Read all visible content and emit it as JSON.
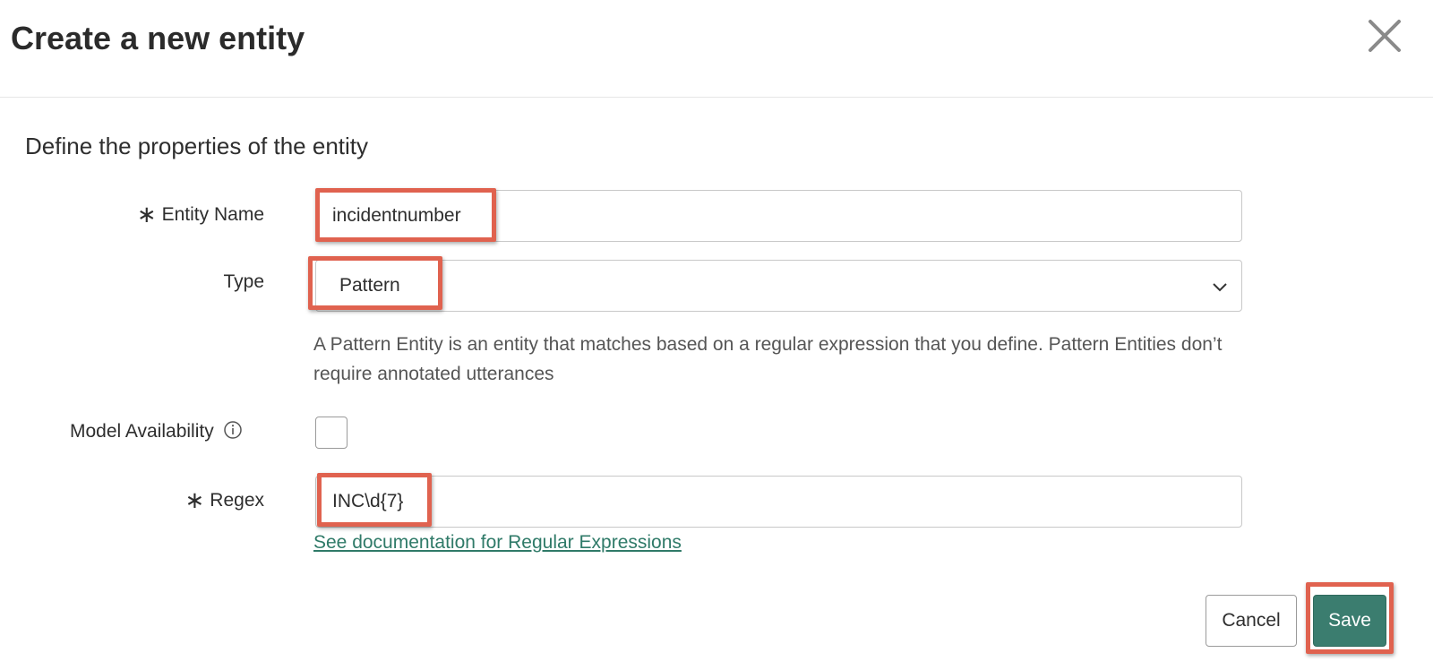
{
  "dialog": {
    "title": "Create a new entity",
    "close_icon": "close-icon"
  },
  "form": {
    "section_title": "Define the properties of the entity",
    "entity_name": {
      "label": "Entity Name",
      "required_marker": "∗",
      "value": "incidentnumber"
    },
    "type": {
      "label": "Type",
      "selected": "Pattern",
      "help_text": "A Pattern Entity is an entity that matches based on a regular expression that you define. Pattern Entities don’t require annotated utterances"
    },
    "model_availability": {
      "label": "Model Availability",
      "checked": false,
      "info_icon": "info-icon"
    },
    "regex": {
      "label": "Regex",
      "required_marker": "∗",
      "value": "INC\\d{7}",
      "doc_link": "See documentation for Regular Expressions"
    }
  },
  "actions": {
    "cancel_label": "Cancel",
    "save_label": "Save"
  },
  "colors": {
    "accent": "#3b7d6f",
    "link": "#2f7a68",
    "highlight": "#e0624f"
  }
}
